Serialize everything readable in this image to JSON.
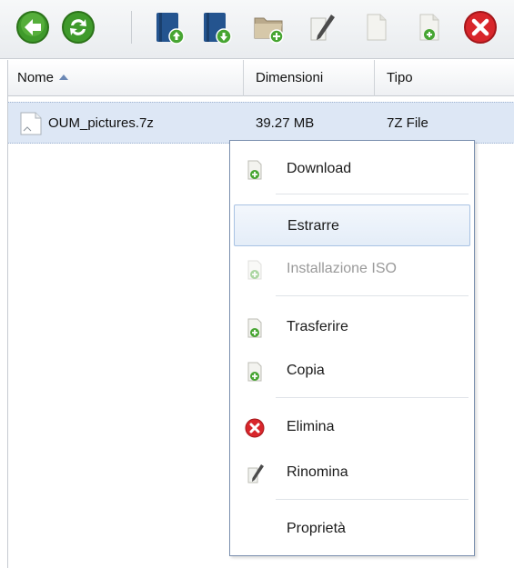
{
  "toolbar": {
    "buttons": [
      {
        "name": "back-button",
        "icon": "arrow-left-circle-icon"
      },
      {
        "name": "refresh-button",
        "icon": "refresh-icon"
      },
      {
        "name": "upload-button",
        "icon": "upload-book-icon"
      },
      {
        "name": "download-button",
        "icon": "download-book-icon"
      },
      {
        "name": "new-folder-button",
        "icon": "folder-add-icon"
      },
      {
        "name": "edit-button",
        "icon": "pencil-paper-icon"
      },
      {
        "name": "copy-button",
        "icon": "page-icon"
      },
      {
        "name": "new-file-button",
        "icon": "page-add-icon"
      },
      {
        "name": "delete-button",
        "icon": "delete-icon"
      }
    ]
  },
  "columns": {
    "name": "Nome",
    "size": "Dimensioni",
    "type": "Tipo",
    "sorted": "asc"
  },
  "files": [
    {
      "name": "OUM_pictures.7z",
      "size": "39.27 MB",
      "type": "7Z File"
    }
  ],
  "context_menu": {
    "download": "Download",
    "extract": "Estrarre",
    "install_iso": "Installazione ISO",
    "transfer": "Trasferire",
    "copy": "Copia",
    "delete": "Elimina",
    "rename": "Rinomina",
    "properties": "Proprietà"
  },
  "colors": {
    "accent": "#4a9a2e",
    "delete": "#d8262b",
    "selection": "#dde7f5",
    "menu_border": "#7a8fae"
  }
}
